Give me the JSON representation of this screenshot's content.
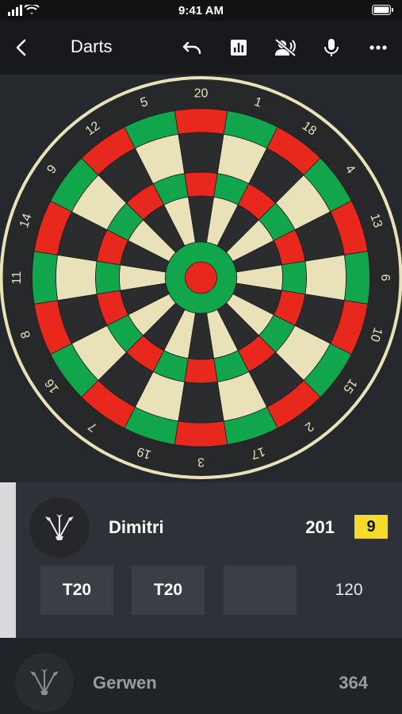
{
  "status_bar": {
    "time": "9:41 AM"
  },
  "nav": {
    "title": "Darts",
    "icons": [
      "back-icon",
      "undo-icon",
      "stats-icon",
      "voice-off-icon",
      "microphone-icon",
      "more-icon"
    ]
  },
  "board": {
    "numbers": [
      "20",
      "1",
      "18",
      "4",
      "13",
      "6",
      "10",
      "15",
      "2",
      "17",
      "3",
      "19",
      "7",
      "16",
      "8",
      "11",
      "14",
      "9",
      "12",
      "5"
    ],
    "colors": {
      "light": "#e9e2b9",
      "dark": "#2b2c2e",
      "red": "#e8281d",
      "green": "#12a64c",
      "surround": "#272829",
      "rim": "#e9e2b9",
      "number_text": "#e9e2b9"
    }
  },
  "active_player": {
    "name": "Dimitri",
    "score": "201",
    "badge": "9",
    "throws": [
      "T20",
      "T20",
      ""
    ],
    "turn_total": "120"
  },
  "next_player": {
    "name": "Gerwen",
    "score": "364"
  },
  "colors": {
    "accent_badge": "#f4db2c",
    "panel_active": "#2e3137",
    "panel_next": "#202327"
  }
}
